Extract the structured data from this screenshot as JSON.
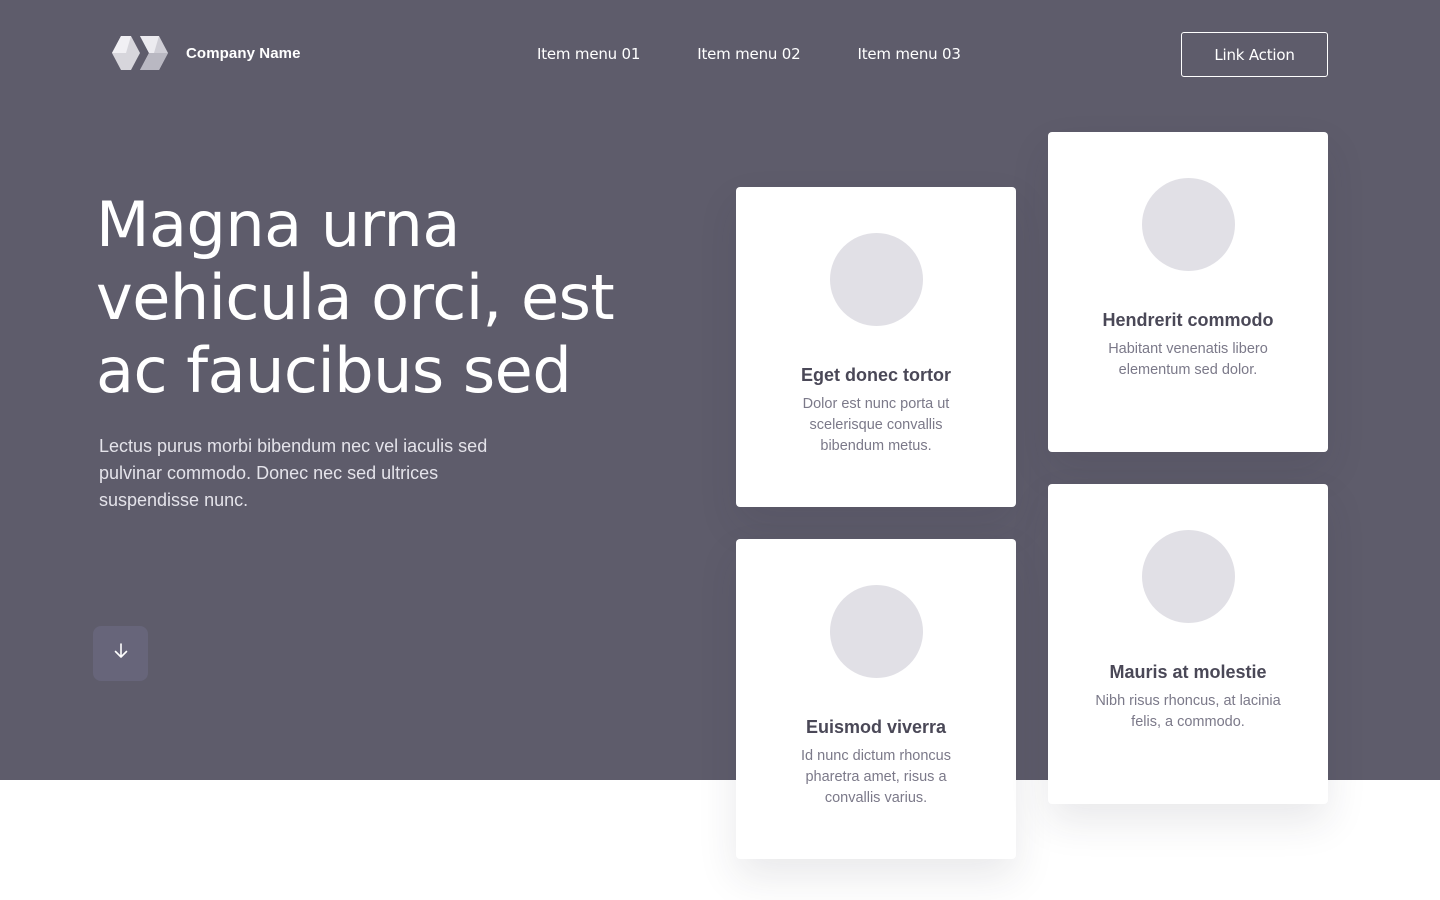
{
  "brand": {
    "name": "Company Name",
    "logo_icon": "hexagon-logo-icon"
  },
  "nav": {
    "items": [
      {
        "label": "Item menu 01"
      },
      {
        "label": "Item menu 02"
      },
      {
        "label": "Item menu 03"
      }
    ],
    "cta_label": "Link Action"
  },
  "hero": {
    "headline": "Magna urna vehicula orci, est ac faucibus sed",
    "lede": "Lectus purus morbi bibendum nec vel iaculis sed pulvinar commodo. Donec nec sed ultrices suspendisse nunc.",
    "scroll_icon": "arrow-down-icon"
  },
  "cards": [
    {
      "title": "Eget donec tortor",
      "text": "Dolor est nunc porta ut scelerisque convallis bibendum metus."
    },
    {
      "title": "Hendrerit commodo",
      "text": "Habitant venenatis libero elementum sed dolor."
    },
    {
      "title": "Euismod viverra",
      "text": "Id nunc dictum rhoncus pharetra amet, risus a convallis varius."
    },
    {
      "title": "Mauris at molestie",
      "text": "Nibh risus rhoncus, at lacinia felis, a commodo."
    }
  ],
  "colors": {
    "hero_bg": "#5e5c6b",
    "card_bg": "#ffffff",
    "avatar_placeholder": "#e1e0e6",
    "card_title": "#4a4857",
    "card_text": "#7b7989"
  }
}
